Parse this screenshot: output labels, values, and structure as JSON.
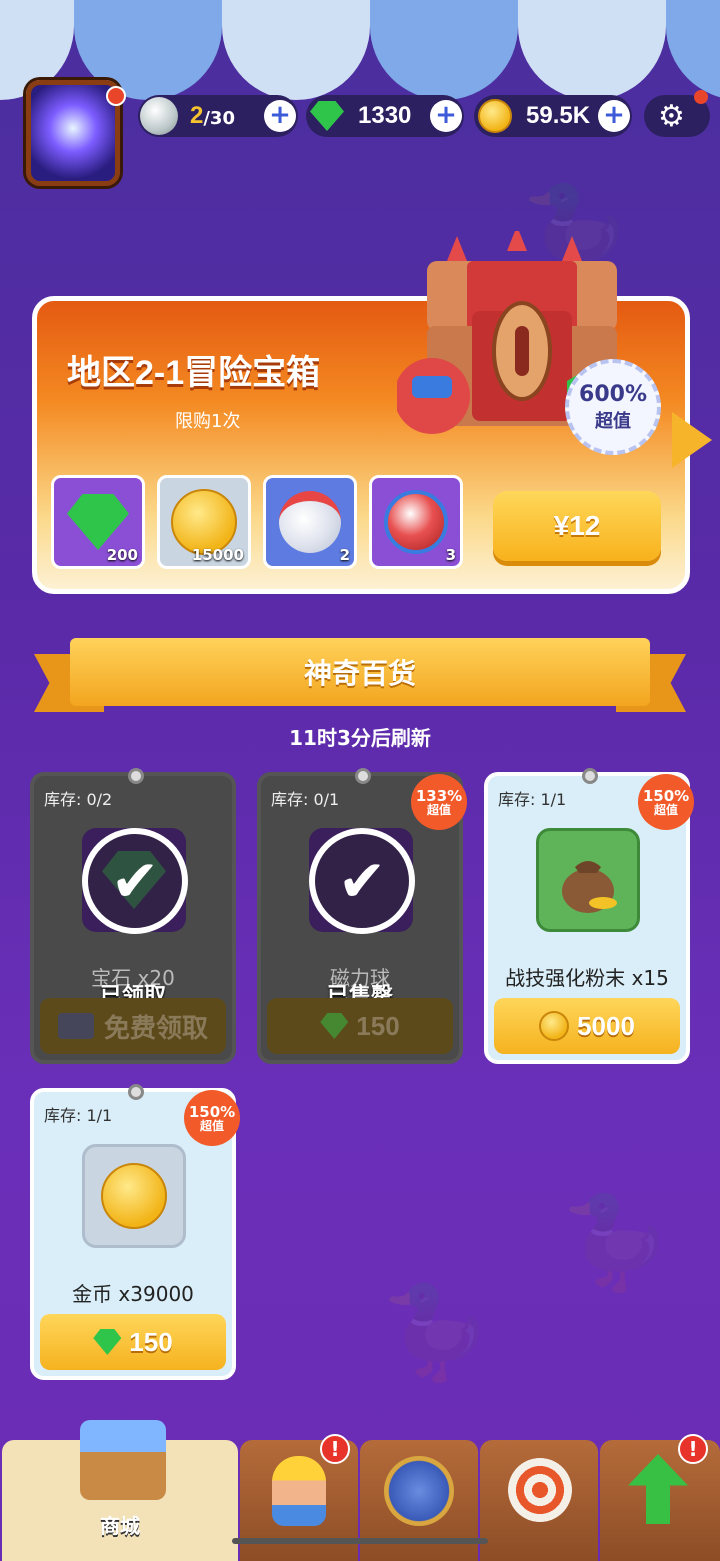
{
  "topbar": {
    "energy": {
      "current": "2",
      "max": "/30",
      "icon": "pearl-icon"
    },
    "gems": {
      "value": "1330",
      "icon": "green-gem-icon"
    },
    "coins": {
      "value": "59.5K",
      "icon": "gold-coin-icon"
    },
    "settings_icon": "gear-icon"
  },
  "offer": {
    "title": "地区2-1冒险宝箱",
    "subtitle": "限购1次",
    "badge_percent": "600%",
    "badge_label": "超值",
    "price": "¥12",
    "items": [
      {
        "icon": "green-gem-icon",
        "qty": "200"
      },
      {
        "icon": "gold-coin-icon",
        "qty": "15000"
      },
      {
        "icon": "magnet-ball-icon",
        "qty": "2"
      },
      {
        "icon": "magnet-ball-red-icon",
        "qty": "3"
      }
    ]
  },
  "section": {
    "title": "神奇百货",
    "refresh": "11时3分后刷新"
  },
  "shop_items": [
    {
      "stock": "库存: 0/2",
      "name": "宝石 x20",
      "status": "已领取",
      "button": "免费领取",
      "icon": "green-gem-icon"
    },
    {
      "stock": "库存: 0/1",
      "name": "磁力球",
      "status": "已售罄",
      "button": "150",
      "badge_percent": "133%",
      "badge_label": "超值",
      "icon": "magnet-ball-icon"
    },
    {
      "stock": "库存: 1/1",
      "name": "战技强化粉末 x15",
      "button": "5000",
      "badge_percent": "150%",
      "badge_label": "超值",
      "icon": "powder-bag-icon"
    },
    {
      "stock": "库存: 1/1",
      "name": "金币 x39000",
      "button": "150",
      "badge_percent": "150%",
      "badge_label": "超值",
      "icon": "gold-coin-icon"
    }
  ],
  "nav": {
    "shop_label": "商城"
  },
  "colors": {
    "accent": "#f5b21f",
    "background": "#5a2aa8",
    "offer_orange": "#e45a12"
  }
}
